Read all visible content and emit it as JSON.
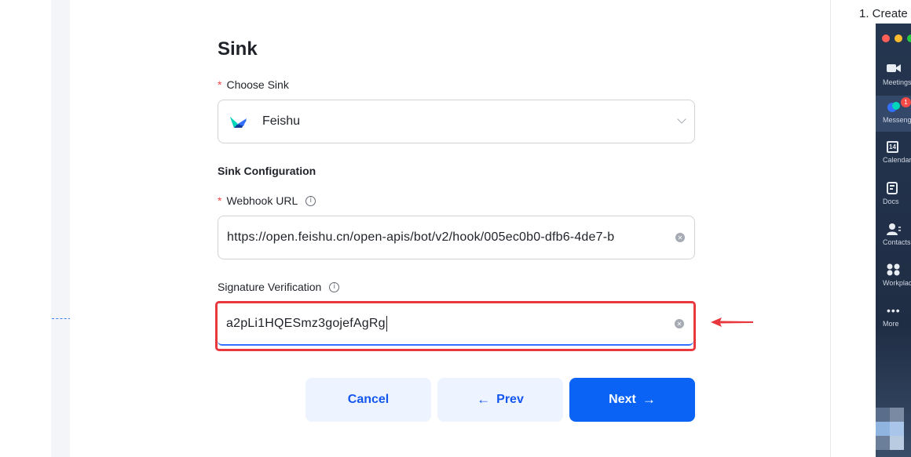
{
  "form": {
    "title": "Sink",
    "choose_sink_label": "Choose Sink",
    "required_mark": "*",
    "selected_sink": "Feishu",
    "section_title": "Sink Configuration",
    "webhook_label": "Webhook URL",
    "webhook_value": "https://open.feishu.cn/open-apis/bot/v2/hook/005ec0b0-dfb6-4de7-b",
    "signature_label": "Signature Verification",
    "signature_value": "a2pLi1HQESmz3gojefAgRg"
  },
  "buttons": {
    "cancel": "Cancel",
    "prev": "Prev",
    "next": "Next"
  },
  "sidebar": {
    "step_text": "1.  Create",
    "items": [
      {
        "label": "Meetings",
        "icon": "video-icon"
      },
      {
        "label": "Messenger",
        "icon": "messenger-icon",
        "badge": "1"
      },
      {
        "label": "Calendar",
        "icon": "calendar-icon",
        "glyph": "14"
      },
      {
        "label": "Docs",
        "icon": "docs-icon"
      },
      {
        "label": "Contacts",
        "icon": "contacts-icon"
      },
      {
        "label": "Workplace",
        "icon": "workplace-icon"
      },
      {
        "label": "More",
        "icon": "more-icon"
      }
    ]
  },
  "colors": {
    "primary": "#0a63f5",
    "highlight": "#e8383d",
    "required": "#f54a45"
  }
}
